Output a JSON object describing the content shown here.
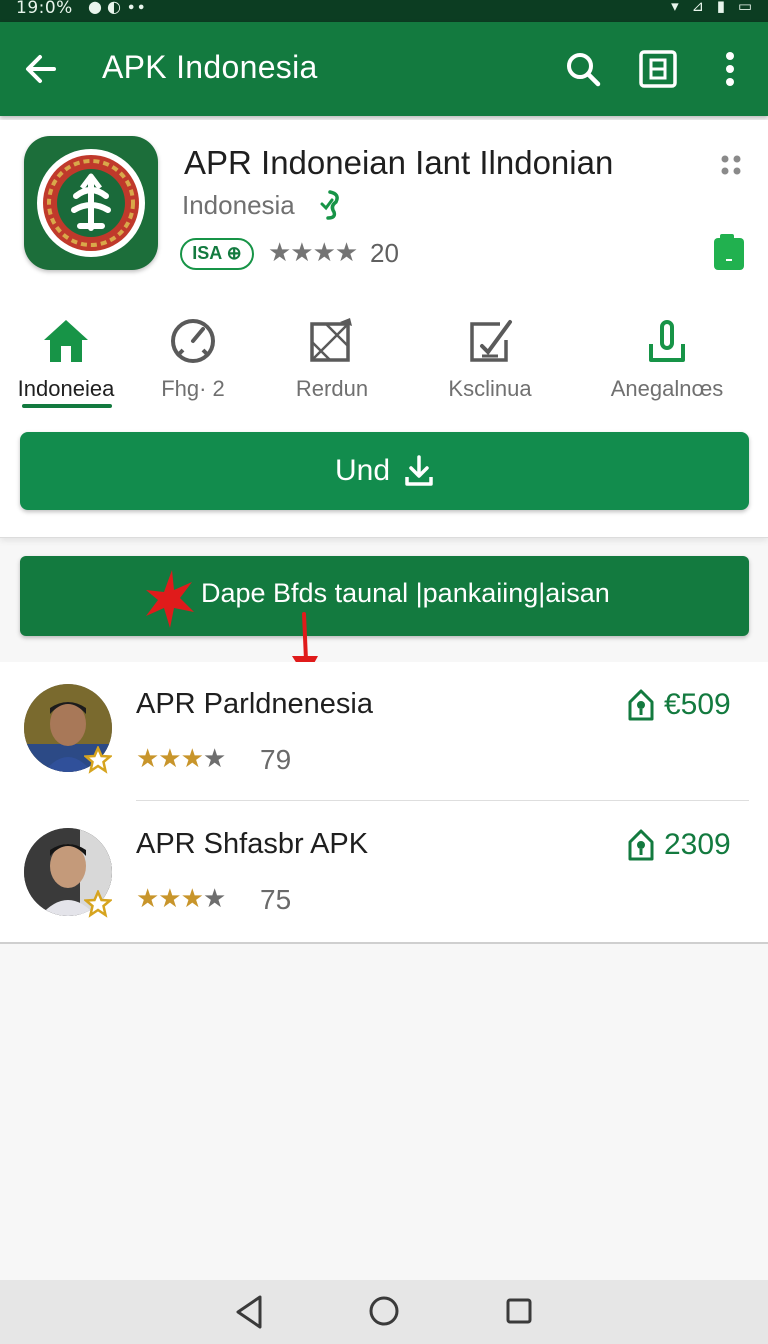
{
  "status_bar": {
    "time": "19:0%",
    "left_icons": "● ◐ ∙∙",
    "right_icons": "▾ ⊿ ▮ ▭"
  },
  "app_bar": {
    "title": "APK Indonesia",
    "back_icon": "arrow-left-icon",
    "search_icon": "search-icon",
    "grid_icon": "grid-icon",
    "menu_icon": "more-vert-icon"
  },
  "app": {
    "name": "APR Indoneian Iant Ilndonian",
    "developer": "Indonesia",
    "badge": "ISA ⊕",
    "stars": "★★★★",
    "rating_count": "20"
  },
  "tabs": [
    {
      "label": "Indoneiea",
      "icon": "home-icon"
    },
    {
      "label": "Fhg· 2",
      "icon": "gauge-icon"
    },
    {
      "label": "Rerdun",
      "icon": "image-edit-icon"
    },
    {
      "label": "Ksclinua",
      "icon": "edit-box-icon"
    },
    {
      "label": "Anegalnœs",
      "icon": "download-bin-icon"
    }
  ],
  "install_button": {
    "label": "Und"
  },
  "promo": {
    "text": "Dape Bfds taunal |pankaiing|aisan"
  },
  "list": [
    {
      "title": "APR Parldnenesia",
      "count": "79",
      "price": "€509",
      "gold_stars": "★★★",
      "grey_stars": "★"
    },
    {
      "title": "APR Shfasbr APK",
      "count": "75",
      "price": "2309",
      "gold_stars": "★★★",
      "grey_stars": "★"
    }
  ],
  "colors": {
    "brand_green": "#137a3f",
    "install_green": "#128c4d",
    "star_gold": "#c8952b",
    "annotation_red": "#e01b1b"
  }
}
